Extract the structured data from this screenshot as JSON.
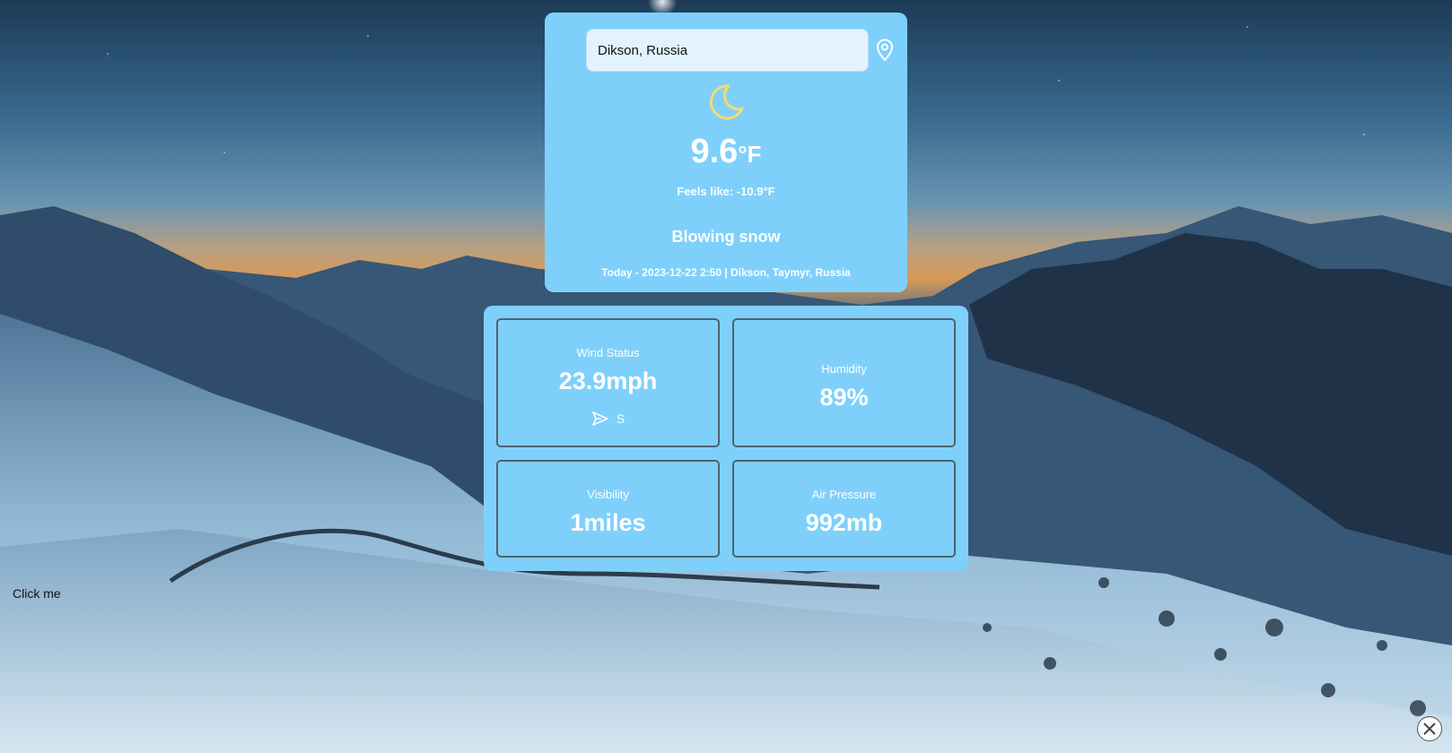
{
  "search": {
    "value": "Dikson, Russia"
  },
  "current": {
    "temp_value": "9.6",
    "temp_unit": "°F",
    "feels_like": "Feels like: -10.9°F",
    "condition": "Blowing snow",
    "date_location": "Today - 2023-12-22 2:50 | Dikson, Taymyr, Russia",
    "icon": "moon-icon"
  },
  "stats": {
    "wind": {
      "label": "Wind Status",
      "value": "23.9mph",
      "direction": "S",
      "direction_icon": "send-arrow-icon"
    },
    "humidity": {
      "label": "Humidity",
      "value": "89%"
    },
    "visibility": {
      "label": "Visibility",
      "value": "1miles"
    },
    "pressure": {
      "label": "Air Pressure",
      "value": "992mb"
    }
  },
  "click_me": {
    "label": "Click me"
  },
  "colors": {
    "card_background": "#7ed0fb",
    "moon": "#f3dc6c",
    "text": "#ffffff"
  }
}
